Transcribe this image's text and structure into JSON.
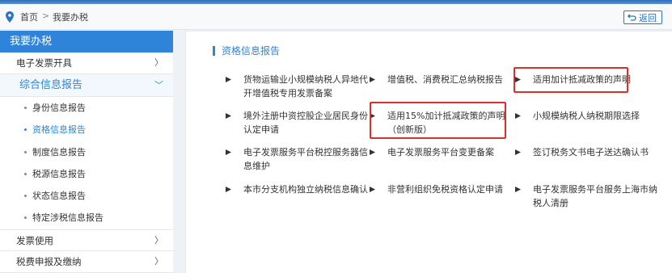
{
  "breadcrumb": {
    "home": "首页",
    "separator": ">",
    "current": "我要办税"
  },
  "back_button": {
    "label": "返回",
    "icon": "return-icon"
  },
  "sidebar": {
    "title": "我要办税",
    "items": [
      {
        "label": "电子发票开具",
        "chevron": "〉"
      },
      {
        "label": "综合信息报告",
        "chevron": "﹀"
      },
      {
        "label": "发票使用",
        "chevron": "〉"
      },
      {
        "label": "税费申报及缴纳",
        "chevron": "〉"
      }
    ],
    "sub_items": [
      "身份信息报告",
      "资格信息报告",
      "制度信息报告",
      "税源信息报告",
      "状态信息报告",
      "特定涉税信息报告"
    ],
    "active_sub_item": "资格信息报告"
  },
  "main": {
    "section_title": "资格信息报告",
    "reports": [
      "货物运输业小规模纳税人异地代开增值税专用发票备案",
      "增值税、消费税汇总纳税报告",
      "适用加计抵减政策的声明",
      "境外注册中资控股企业居民身份认定申请",
      "适用15%加计抵减政策的声明（创新版）",
      "小规模纳税人纳税期限选择",
      "电子发票服务平台税控服务器信息维护",
      "电子发票服务平台变更备案",
      "签订税务文书电子送达确认书",
      "本市分支机构独立纳税信息确认",
      "非营利组织免税资格认定申请",
      "电子发票服务平台服务上海市纳税人清册"
    ],
    "highlighted": [
      "适用加计抵减政策的声明",
      "适用15%加计抵减政策的声明（创新版）"
    ]
  },
  "colors": {
    "accent": "#2f83d9",
    "highlight_border": "#d9302a",
    "top_bar": "#2f6db6"
  }
}
